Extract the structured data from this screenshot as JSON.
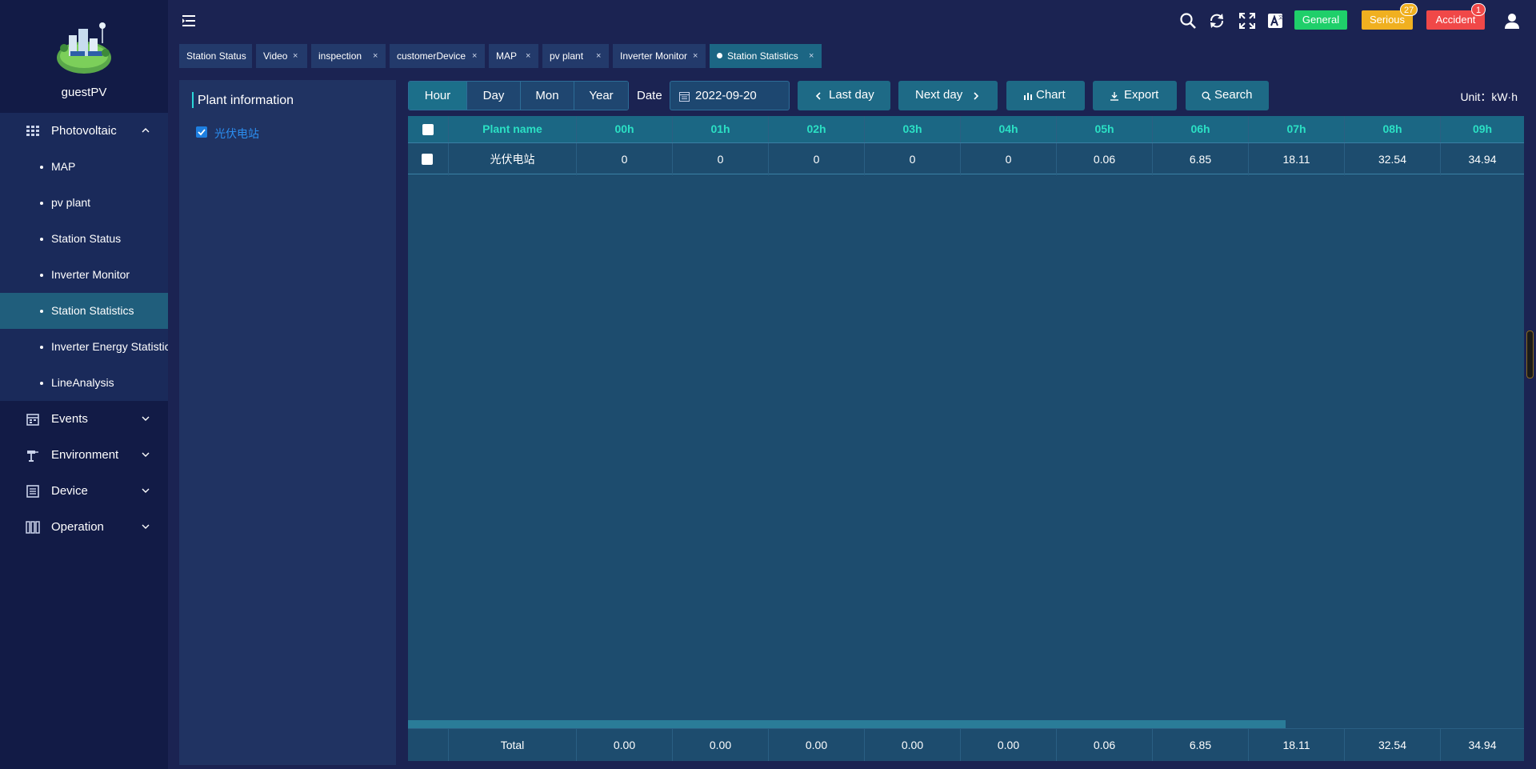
{
  "user": {
    "name": "guestPV"
  },
  "sidebar": {
    "groups": [
      {
        "label": "Photovoltaic",
        "icon": "grid-panel-icon",
        "expanded": true
      },
      {
        "label": "Events",
        "icon": "calendar-icon"
      },
      {
        "label": "Environment",
        "icon": "weather-station-icon"
      },
      {
        "label": "Device",
        "icon": "device-list-icon"
      },
      {
        "label": "Operation",
        "icon": "operation-icon"
      }
    ],
    "subitems": [
      {
        "label": "MAP"
      },
      {
        "label": "pv plant"
      },
      {
        "label": "Station Status"
      },
      {
        "label": "Inverter Monitor"
      },
      {
        "label": "Station Statistics",
        "active": true
      },
      {
        "label": "Inverter Energy Statistics"
      },
      {
        "label": "LineAnalysis"
      }
    ]
  },
  "topbar": {
    "icons": [
      "search-icon",
      "refresh-icon",
      "fullscreen-icon",
      "translate-icon",
      "user-icon"
    ],
    "severity": [
      {
        "label": "General",
        "color": "#1fcf6a"
      },
      {
        "label": "Serious",
        "color": "#f0b020",
        "badge": "27"
      },
      {
        "label": "Accident",
        "color": "#f04848",
        "badge": "1"
      }
    ]
  },
  "tabs": [
    {
      "label": "Station Status",
      "closable": false
    },
    {
      "label": "Video",
      "closable": true
    },
    {
      "label": "inspection",
      "closable": true
    },
    {
      "label": "customerDevice",
      "closable": true
    },
    {
      "label": "MAP",
      "closable": true
    },
    {
      "label": "pv plant",
      "closable": true
    },
    {
      "label": "Inverter Monitor",
      "closable": true
    },
    {
      "label": "Station Statistics",
      "closable": true,
      "active": true
    }
  ],
  "close_glyph": "×",
  "plant_panel": {
    "title": "Plant information",
    "items": [
      {
        "label": "光伏电站",
        "checked": true
      }
    ]
  },
  "toolbar": {
    "periods": [
      "Hour",
      "Day",
      "Mon",
      "Year"
    ],
    "active_period": "Hour",
    "date_label": "Date",
    "date_value": "2022-09-20",
    "last_day": "Last day",
    "next_day": "Next day",
    "chart": "Chart",
    "export": "Export",
    "search": "Search",
    "unit": "Unit：kW·h"
  },
  "table": {
    "columns": [
      "Plant name",
      "00h",
      "01h",
      "02h",
      "03h",
      "04h",
      "05h",
      "06h",
      "07h",
      "08h",
      "09h"
    ],
    "rows": [
      [
        "光伏电站",
        "0",
        "0",
        "0",
        "0",
        "0",
        "0.06",
        "6.85",
        "18.11",
        "32.54",
        "34.94"
      ]
    ],
    "total": [
      "Total",
      "0.00",
      "0.00",
      "0.00",
      "0.00",
      "0.00",
      "0.06",
      "6.85",
      "18.11",
      "32.54",
      "34.94"
    ]
  }
}
